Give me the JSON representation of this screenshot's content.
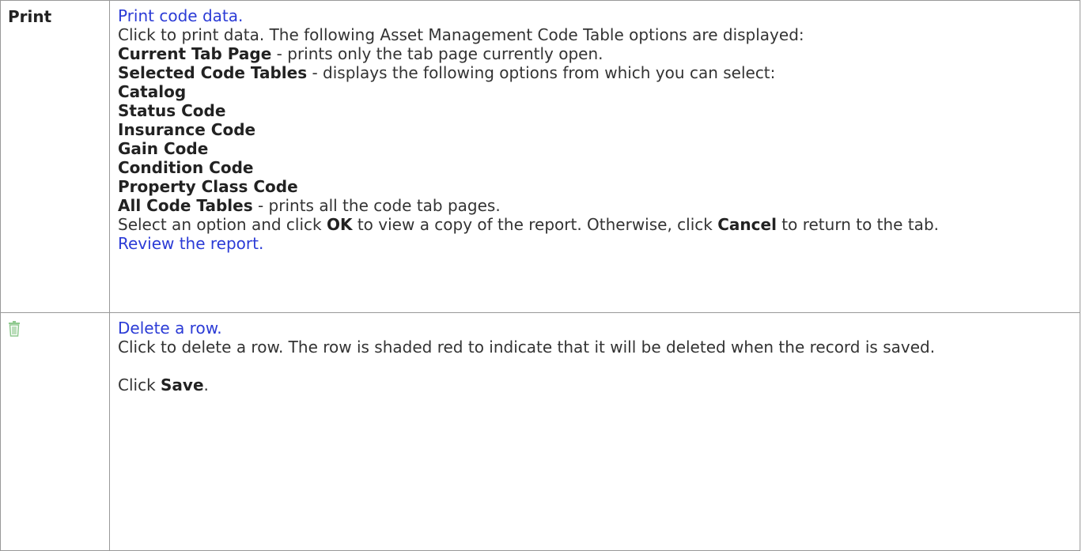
{
  "print_row": {
    "label": "Print",
    "link_print": "Print code data.",
    "intro": "Click to print data. The following Asset Management Code Table options are displayed:",
    "current_tab": {
      "term": "Current Tab Page",
      "desc": " - prints only the tab page currently open."
    },
    "selected_tables": {
      "term": "Selected Code Tables",
      "desc": " - displays the following options from which you can select:"
    },
    "options": [
      "Catalog",
      "Status Code",
      "Insurance Code",
      "Gain Code",
      "Condition Code",
      "Property Class Code"
    ],
    "all_tables": {
      "term": "All Code Tables",
      "desc": " - prints all the code tab pages."
    },
    "select_text_1": "Select an option and click ",
    "ok": "OK",
    "select_text_2": " to view a copy of the report. Otherwise, click ",
    "cancel": "Cancel",
    "select_text_3": " to return to the tab.",
    "link_review": "Review the report."
  },
  "delete_row": {
    "icon": "trash-icon",
    "link_delete": "Delete a row.",
    "desc": "Click to delete a row. The row is shaded red to indicate that it will be deleted when the record is saved.",
    "click_text": "Click ",
    "save": "Save",
    "period": "."
  },
  "colors": {
    "link": "#2b3bd6",
    "border": "#999999",
    "icon": "#8fc98f"
  }
}
